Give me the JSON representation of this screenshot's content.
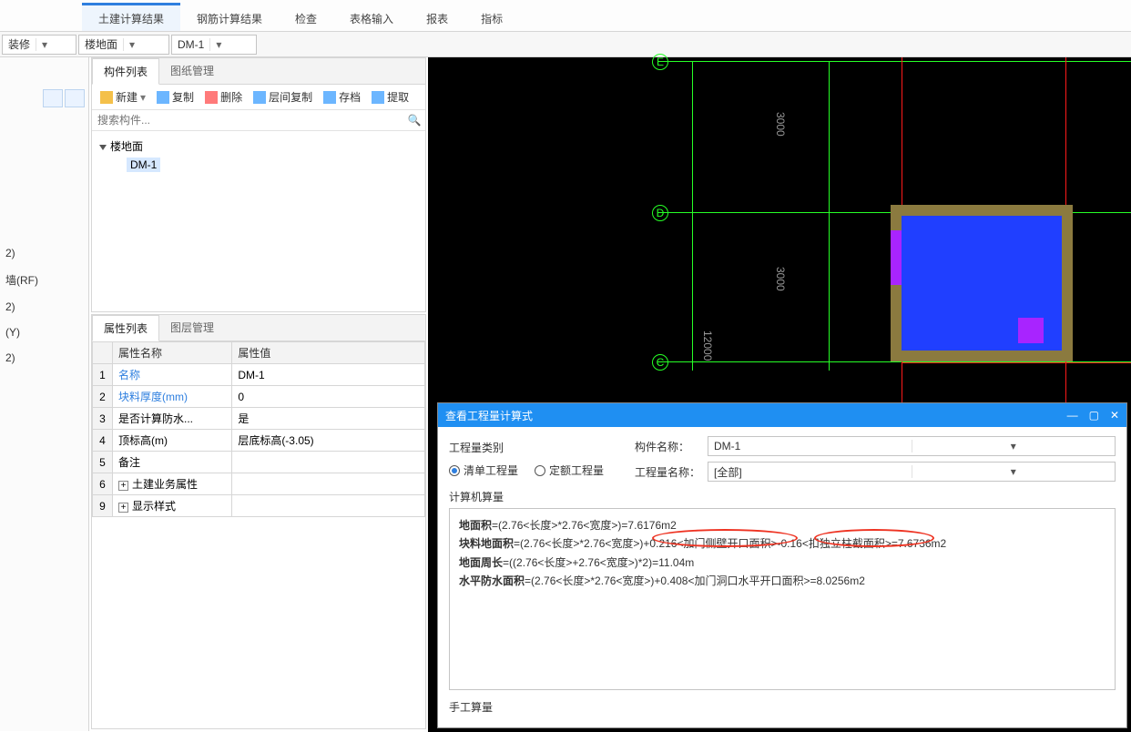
{
  "ribbon": {
    "tabs": [
      "土建计算结果",
      "钢筋计算结果",
      "检查",
      "表格输入",
      "报表",
      "指标"
    ],
    "active": 0
  },
  "selectors": {
    "a": "装修",
    "b": "楼地面",
    "c": "DM-1"
  },
  "left_items": [
    "2)",
    "墙(RF)",
    "2)",
    "(Y)",
    "2)"
  ],
  "comp_panel": {
    "tabs": [
      "构件列表",
      "图纸管理"
    ],
    "toolbar": {
      "new": "新建",
      "copy": "复制",
      "del": "删除",
      "dup": "层间复制",
      "save": "存档",
      "ext": "提取"
    },
    "search_ph": "搜索构件...",
    "root": "楼地面",
    "item": "DM-1"
  },
  "prop_panel": {
    "tabs": [
      "属性列表",
      "图层管理"
    ],
    "cols": [
      "属性名称",
      "属性值"
    ],
    "rows": [
      {
        "n": "1",
        "name": "名称",
        "val": "DM-1",
        "blue": true
      },
      {
        "n": "2",
        "name": "块料厚度(mm)",
        "val": "0",
        "blue": true
      },
      {
        "n": "3",
        "name": "是否计算防水...",
        "val": "是"
      },
      {
        "n": "4",
        "name": "顶标高(m)",
        "val": "层底标高(-3.05)"
      },
      {
        "n": "5",
        "name": "备注",
        "val": ""
      },
      {
        "n": "6",
        "name": "土建业务属性",
        "val": "",
        "exp": true
      },
      {
        "n": "9",
        "name": "显示样式",
        "val": "",
        "exp": true
      }
    ]
  },
  "canvas": {
    "axes": [
      "E",
      "D",
      "C"
    ],
    "dims": [
      "3000",
      "3000",
      "12000"
    ]
  },
  "dialog": {
    "title": "查看工程量计算式",
    "cat_label": "工程量类别",
    "radio1": "清单工程量",
    "radio2": "定额工程量",
    "name_label": "构件名称：",
    "name_val": "DM-1",
    "proj_label": "工程量名称：",
    "proj_val": "[全部]",
    "calc_label": "计算机算量",
    "manual_label": "手工算量",
    "lines": [
      {
        "b": "地面积",
        "t": "=(2.76<长度>*2.76<宽度>)=7.6176m2"
      },
      {
        "b": "块料地面积",
        "t": "=(2.76<长度>*2.76<宽度>)+0.216<加门侧壁开口面积>-0.16<扣独立柱截面积>=7.6736m2"
      },
      {
        "b": "地面周长",
        "t": "=((2.76<长度>+2.76<宽度>)*2)=11.04m"
      },
      {
        "b": "水平防水面积",
        "t": "=(2.76<长度>*2.76<宽度>)+0.408<加门洞口水平开口面积>=8.0256m2"
      }
    ]
  }
}
